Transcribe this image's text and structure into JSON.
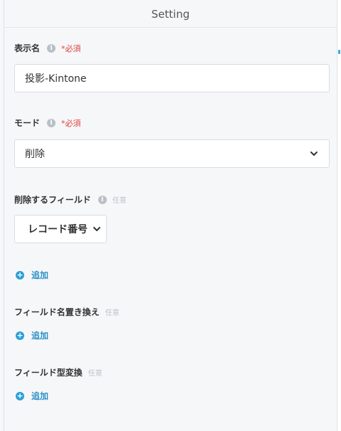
{
  "header": {
    "title": "Setting"
  },
  "display_name": {
    "label": "表示名",
    "required": "*必須",
    "value": "投影-Kintone"
  },
  "mode": {
    "label": "モード",
    "required": "*必須",
    "value": "削除"
  },
  "delete_fields": {
    "label": "削除するフィールド",
    "optional": "任意",
    "selected": "レコード番号",
    "add_label": "追加"
  },
  "rename_fields": {
    "label": "フィールド名置き換え",
    "optional": "任意",
    "add_label": "追加"
  },
  "type_convert": {
    "label": "フィールド型変換",
    "optional": "任意",
    "add_label": "追加"
  },
  "icons": {
    "info": "info-icon",
    "plus": "plus-circle-icon",
    "chevron": "chevron-down-icon"
  },
  "colors": {
    "accent": "#2a9fd8",
    "required": "#e0403a"
  }
}
